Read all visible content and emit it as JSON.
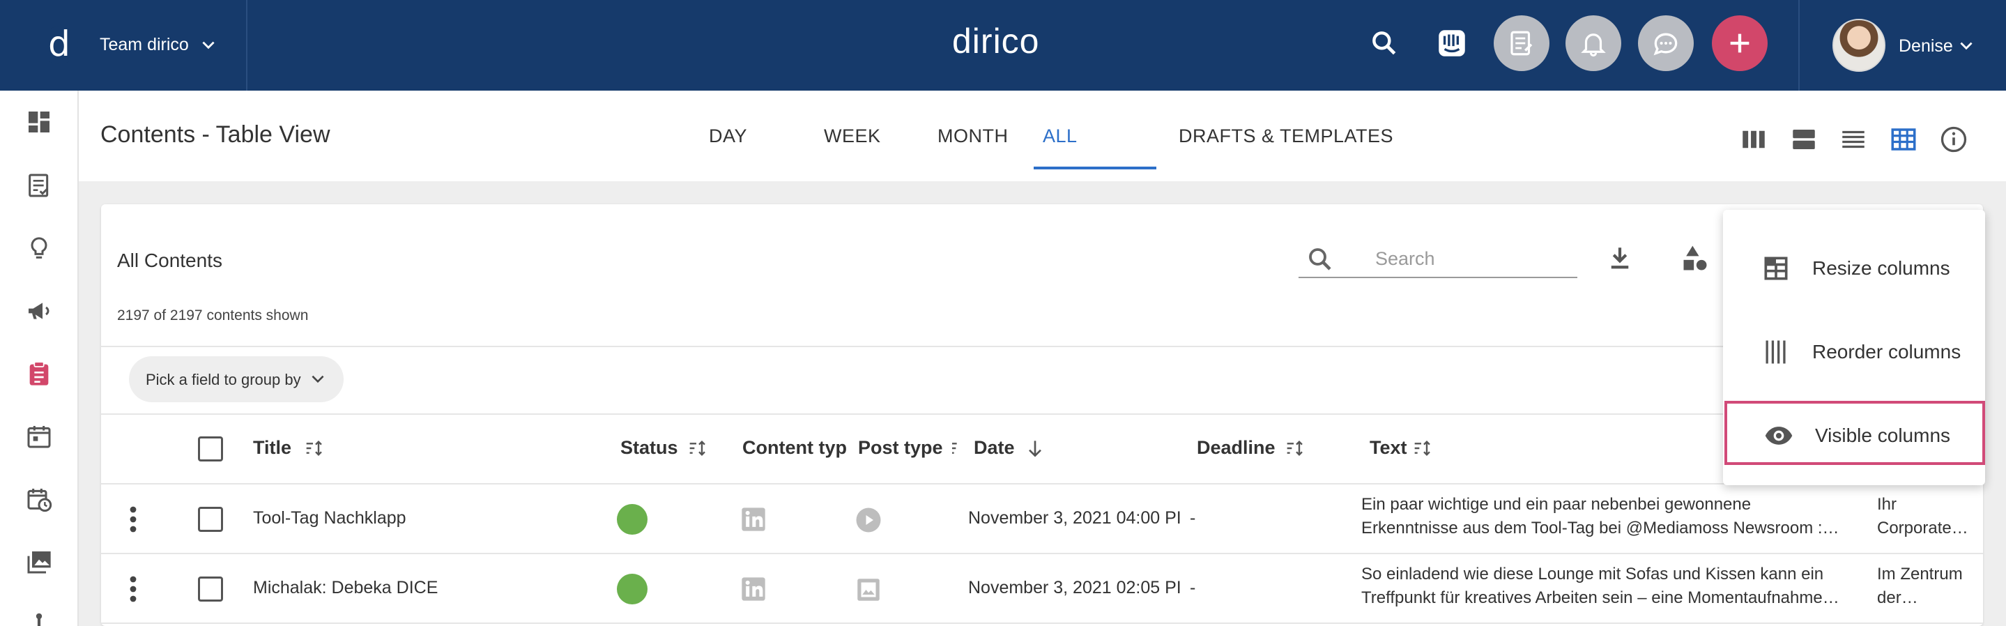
{
  "topbar": {
    "logo_letter": "d",
    "team_name": "Team dirico",
    "brand": "dirico",
    "user_name": "Denise",
    "colors": {
      "navy": "#163a6b",
      "accent_red": "#d2476a",
      "icon_grey": "#b9bcc2"
    }
  },
  "header": {
    "page_title": "Contents - Table View",
    "tabs": [
      {
        "label": "DAY"
      },
      {
        "label": "WEEK"
      },
      {
        "label": "MONTH"
      },
      {
        "label": "ALL",
        "active": true
      },
      {
        "label": "DRAFTS & TEMPLATES"
      }
    ]
  },
  "card": {
    "title": "All Contents",
    "count_text": "2197 of 2197 contents shown",
    "search_placeholder": "Search",
    "group_by_label": "Pick a field to group by"
  },
  "table": {
    "columns": [
      "Title",
      "Status",
      "Content typ",
      "Post type",
      "Date",
      "Deadline",
      "Text"
    ],
    "rows": [
      {
        "title": "Tool-Tag Nachklapp",
        "status": "green",
        "content_type_icon": "linkedin-icon",
        "post_type_icon": "video-icon",
        "date": "November 3, 2021 04:00 PI",
        "deadline": "-",
        "text_line1": "Ein paar wichtige und ein paar nebenbei gewonnene",
        "text_line2": "Erkenntnisse aus dem Tool-Tag bei @Mediamoss Newsroom :…",
        "extra_line1": "Ihr",
        "extra_line2": "Corporate…"
      },
      {
        "title": "Michalak: Debeka DICE",
        "status": "green",
        "content_type_icon": "linkedin-icon",
        "post_type_icon": "image-icon",
        "date": "November 3, 2021 02:05 PI",
        "deadline": "-",
        "text_line1": "So einladend wie diese Lounge mit Sofas und Kissen kann ein",
        "text_line2": "Treffpunkt für kreatives Arbeiten sein – eine Momentaufnahme…",
        "extra_line1": "Im Zentrum",
        "extra_line2": "der…"
      }
    ]
  },
  "menu": {
    "items": [
      {
        "label": "Resize columns",
        "icon": "resize-columns-icon"
      },
      {
        "label": "Reorder columns",
        "icon": "reorder-columns-icon"
      },
      {
        "label": "Visible columns",
        "icon": "eye-icon",
        "highlighted": true
      }
    ]
  }
}
